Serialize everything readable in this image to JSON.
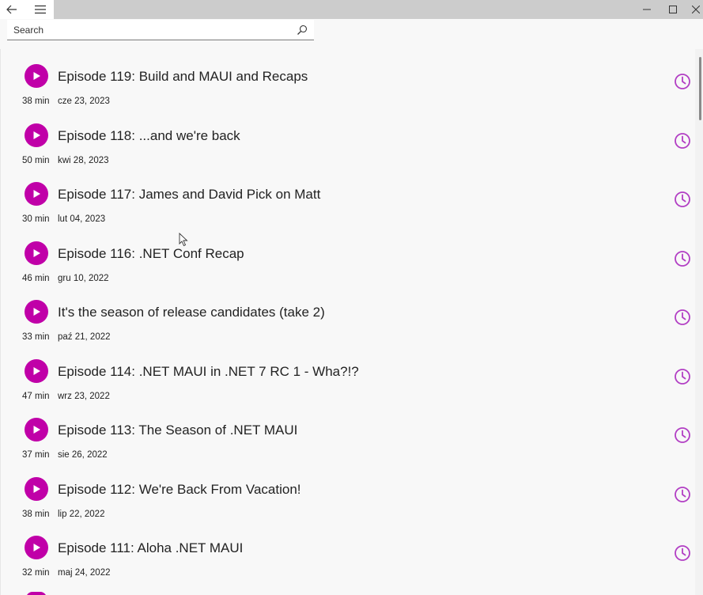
{
  "titlebar": {
    "back_icon": "back-arrow-icon",
    "menu_icon": "hamburger-icon",
    "minimize_symbol": "—",
    "maximize_symbol": "☐",
    "close_symbol": "✕"
  },
  "search": {
    "placeholder": "Search",
    "icon": "search-icon"
  },
  "colors": {
    "accent": "#c000a8",
    "clock": "#b23fc4"
  },
  "episodes": [
    {
      "title": "Episode 119: Build and MAUI and Recaps",
      "duration": "38 min",
      "date": "cze 23, 2023"
    },
    {
      "title": "Episode 118: ...and we're back",
      "duration": "50 min",
      "date": "kwi 28, 2023"
    },
    {
      "title": "Episode 117: James and David Pick on Matt",
      "duration": "30 min",
      "date": "lut 04, 2023"
    },
    {
      "title": "Episode 116: .NET Conf Recap",
      "duration": "46 min",
      "date": "gru 10, 2022"
    },
    {
      "title": "It's the season of release candidates (take 2)",
      "duration": "33 min",
      "date": "paź 21, 2022"
    },
    {
      "title": "Episode 114: .NET MAUI in .NET 7 RC 1 - Wha?!?",
      "duration": "47 min",
      "date": "wrz 23, 2022"
    },
    {
      "title": "Episode 113: The Season of .NET MAUI",
      "duration": "37 min",
      "date": "sie 26, 2022"
    },
    {
      "title": "Episode 112: We're Back From Vacation!",
      "duration": "38 min",
      "date": "lip 22, 2022"
    },
    {
      "title": "Episode 111: Aloha .NET MAUI",
      "duration": "32 min",
      "date": "maj 24, 2022"
    }
  ]
}
